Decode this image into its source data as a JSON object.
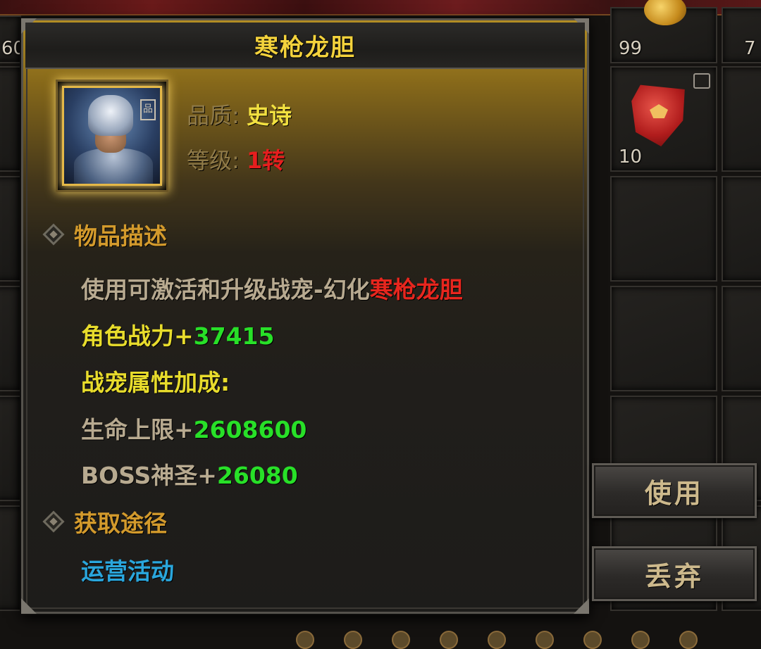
{
  "background": {
    "slots": [
      {
        "count": "60"
      },
      {
        "count": "99"
      },
      {
        "count": "7"
      },
      {
        "count": "10"
      }
    ]
  },
  "tooltip": {
    "title": "寒枪龙胆",
    "quality_label": "品质:",
    "quality_value": "史诗",
    "level_label": "等级:",
    "level_value": "1转",
    "grade_tag": "品",
    "description_header": "物品描述",
    "desc_prefix": "使用可激活和升级战宠-幻化",
    "desc_highlight": "寒枪龙胆",
    "power_label": "角色战力+",
    "power_value": "37415",
    "bonus_header": "战宠属性加成:",
    "hp_label": "生命上限+",
    "hp_value": "2608600",
    "boss_label": "BOSS神圣+",
    "boss_value": "26080",
    "source_header": "获取途径",
    "source_value": "运营活动"
  },
  "buttons": {
    "use": "使用",
    "discard": "丢弃"
  },
  "colors": {
    "title": "#f3d23c",
    "quality": "#f2e040",
    "level": "#e61e1e",
    "section_header": "#d39a2c",
    "green_value": "#28e028",
    "source_link": "#2aa6dc"
  }
}
